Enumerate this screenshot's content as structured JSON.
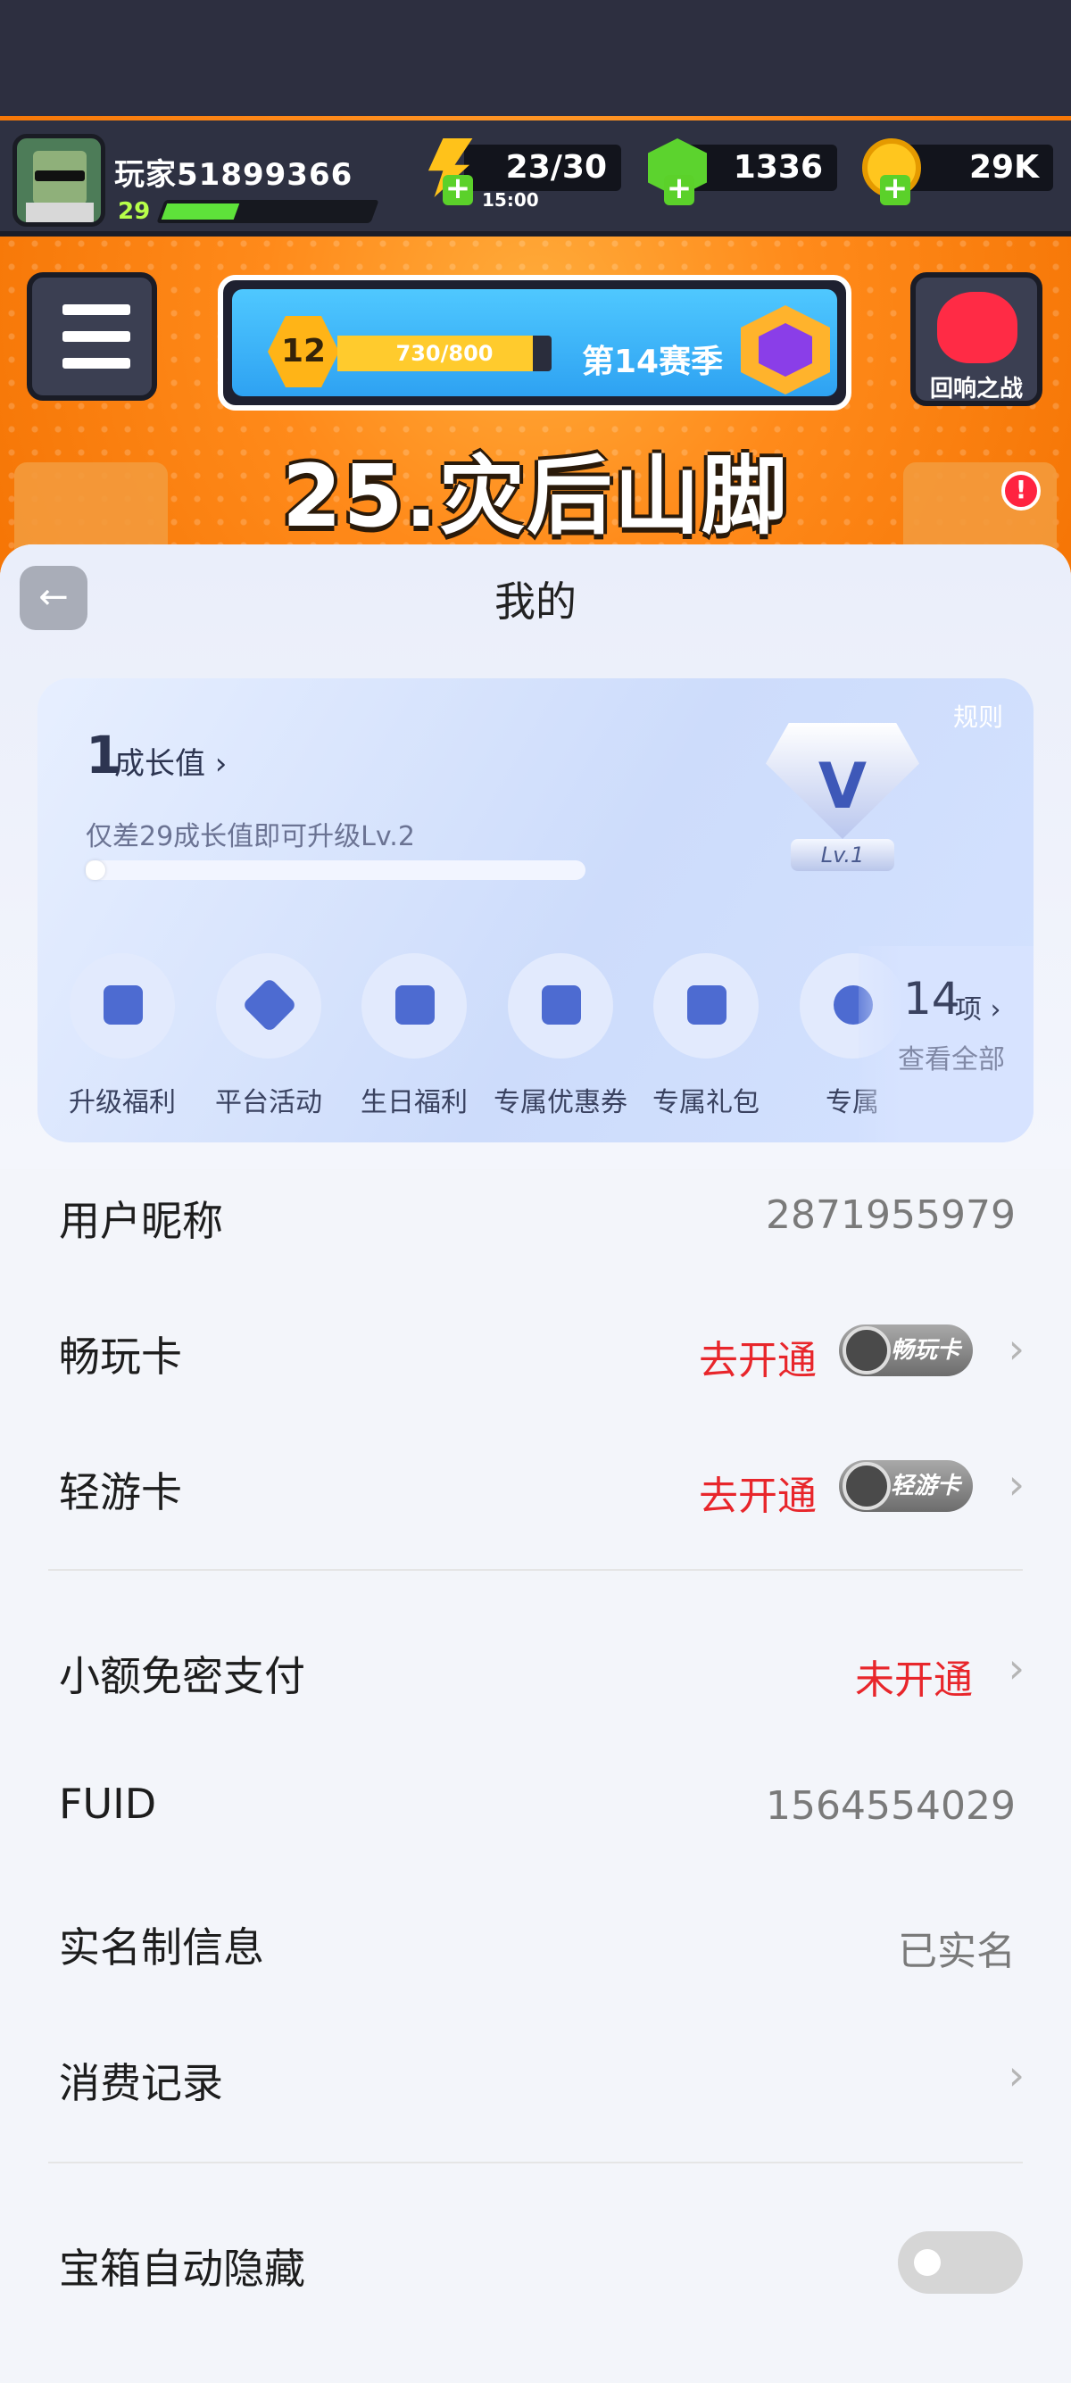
{
  "game": {
    "player_name": "玩家51899366",
    "player_level": "29",
    "xp_progress": 0.35,
    "energy": "23/30",
    "energy_timer": "15:00",
    "gems": "1336",
    "coins": "29K",
    "season_level": "12",
    "season_xp": "730/800",
    "season_progress": 0.9125,
    "season_title": "第14赛季",
    "event_label": "回响之战",
    "stage_title": "25.灾后山脚",
    "notification_badge": "!",
    "plus_symbol": "+"
  },
  "sheet": {
    "back_icon": "←",
    "title": "我的"
  },
  "vip": {
    "rules_label": "规则",
    "growth_value": "1",
    "growth_label": "成长值 ›",
    "upgrade_hint": "仅差29成长值即可升级Lv.2",
    "growth_progress": 0.03,
    "badge_letter": "V",
    "badge_level": "Lv.1",
    "perks": [
      {
        "label": "升级福利",
        "icon": "gift-box-icon"
      },
      {
        "label": "平台活动",
        "icon": "tag-icon"
      },
      {
        "label": "生日福利",
        "icon": "cake-icon"
      },
      {
        "label": "专属优惠券",
        "icon": "coupon-icon"
      },
      {
        "label": "专属礼包",
        "icon": "gift-icon"
      },
      {
        "label": "专属",
        "icon": "headset-icon"
      }
    ],
    "perk_count": "14",
    "perk_unit": "项 ›",
    "view_all": "查看全部"
  },
  "rows": {
    "nickname": {
      "label": "用户昵称",
      "value": "2871955979"
    },
    "play_card": {
      "label": "畅玩卡",
      "action": "去开通",
      "chip": "畅玩卡"
    },
    "lite_card": {
      "label": "轻游卡",
      "action": "去开通",
      "chip": "轻游卡"
    },
    "small_pay": {
      "label": "小额免密支付",
      "value": "未开通"
    },
    "fuid": {
      "label": "FUID",
      "value": "1564554029"
    },
    "realname": {
      "label": "实名制信息",
      "value": "已实名"
    },
    "consume": {
      "label": "消费记录"
    },
    "chest_hide": {
      "label": "宝箱自动隐藏",
      "enabled": false
    },
    "chevron": "›"
  },
  "colors": {
    "accent_red": "#e8262b",
    "game_orange": "#ff8a1a",
    "vip_blue": "#cddcfb"
  }
}
